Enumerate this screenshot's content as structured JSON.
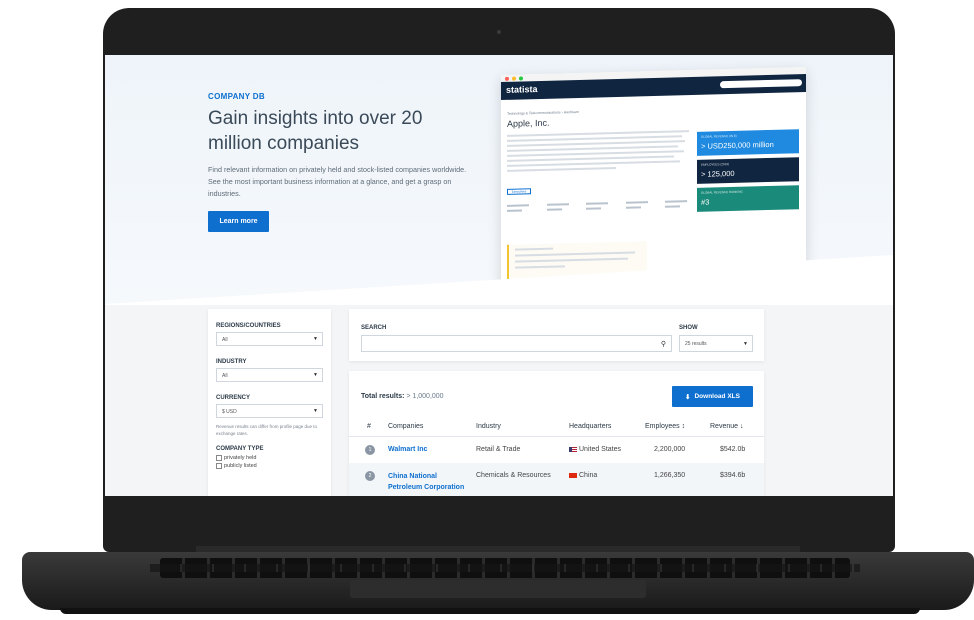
{
  "hero": {
    "eyebrow": "COMPANY DB",
    "title": "Gain insights into over 20 million companies",
    "lead": "Find relevant information on privately held and stock-listed companies worldwide. See the most important business information at a glance, and get a grasp on industries.",
    "cta_label": "Learn more"
  },
  "mock": {
    "logo": "statista",
    "crumb": "Technology & Telecommunications › Hardware",
    "company": "Apple, Inc.",
    "tag": "Executives",
    "cards": [
      {
        "label": "GLOBAL REVENUE (IN $)",
        "value": "> USD250,000 million",
        "color": "#1f8ae0"
      },
      {
        "label": "EMPLOYEES (2019)",
        "value": "> 125,000",
        "color": "#0f2540"
      },
      {
        "label": "GLOBAL REVENUE RANKING",
        "value": "#3",
        "color": "#1a8a7a"
      }
    ]
  },
  "filters": {
    "regions_label": "REGIONS/COUNTRIES",
    "regions_value": "All",
    "industry_label": "INDUSTRY",
    "industry_value": "All",
    "currency_label": "CURRENCY",
    "currency_value": "$ USD",
    "currency_note": "Revenue results can differ from profile page due to exchange rates.",
    "company_type_label": "COMPANY TYPE",
    "company_types": [
      "privately held",
      "publicly listed"
    ]
  },
  "search": {
    "label": "SEARCH",
    "placeholder": "",
    "show_label": "SHOW",
    "show_value": "25 results"
  },
  "results": {
    "total_label": "Total results:",
    "total_value": "> 1,000,000",
    "download_label": "Download XLS",
    "columns": [
      "#",
      "Companies",
      "Industry",
      "Headquarters",
      "Employees ↕",
      "Revenue ↓"
    ],
    "rows": [
      {
        "rank": "1",
        "company": "Walmart Inc",
        "industry": "Retail & Trade",
        "hq": "United States",
        "employees": "2,200,000",
        "revenue": "$542.0b"
      },
      {
        "rank": "2",
        "company": "China National Petroleum Corporation",
        "industry": "Chemicals & Resources",
        "hq": "China",
        "employees": "1,266,350",
        "revenue": "$394.6b"
      }
    ]
  },
  "colors": {
    "accent": "#0e6fcf",
    "navy": "#0f2540",
    "bezel": "#1f1f1f"
  }
}
